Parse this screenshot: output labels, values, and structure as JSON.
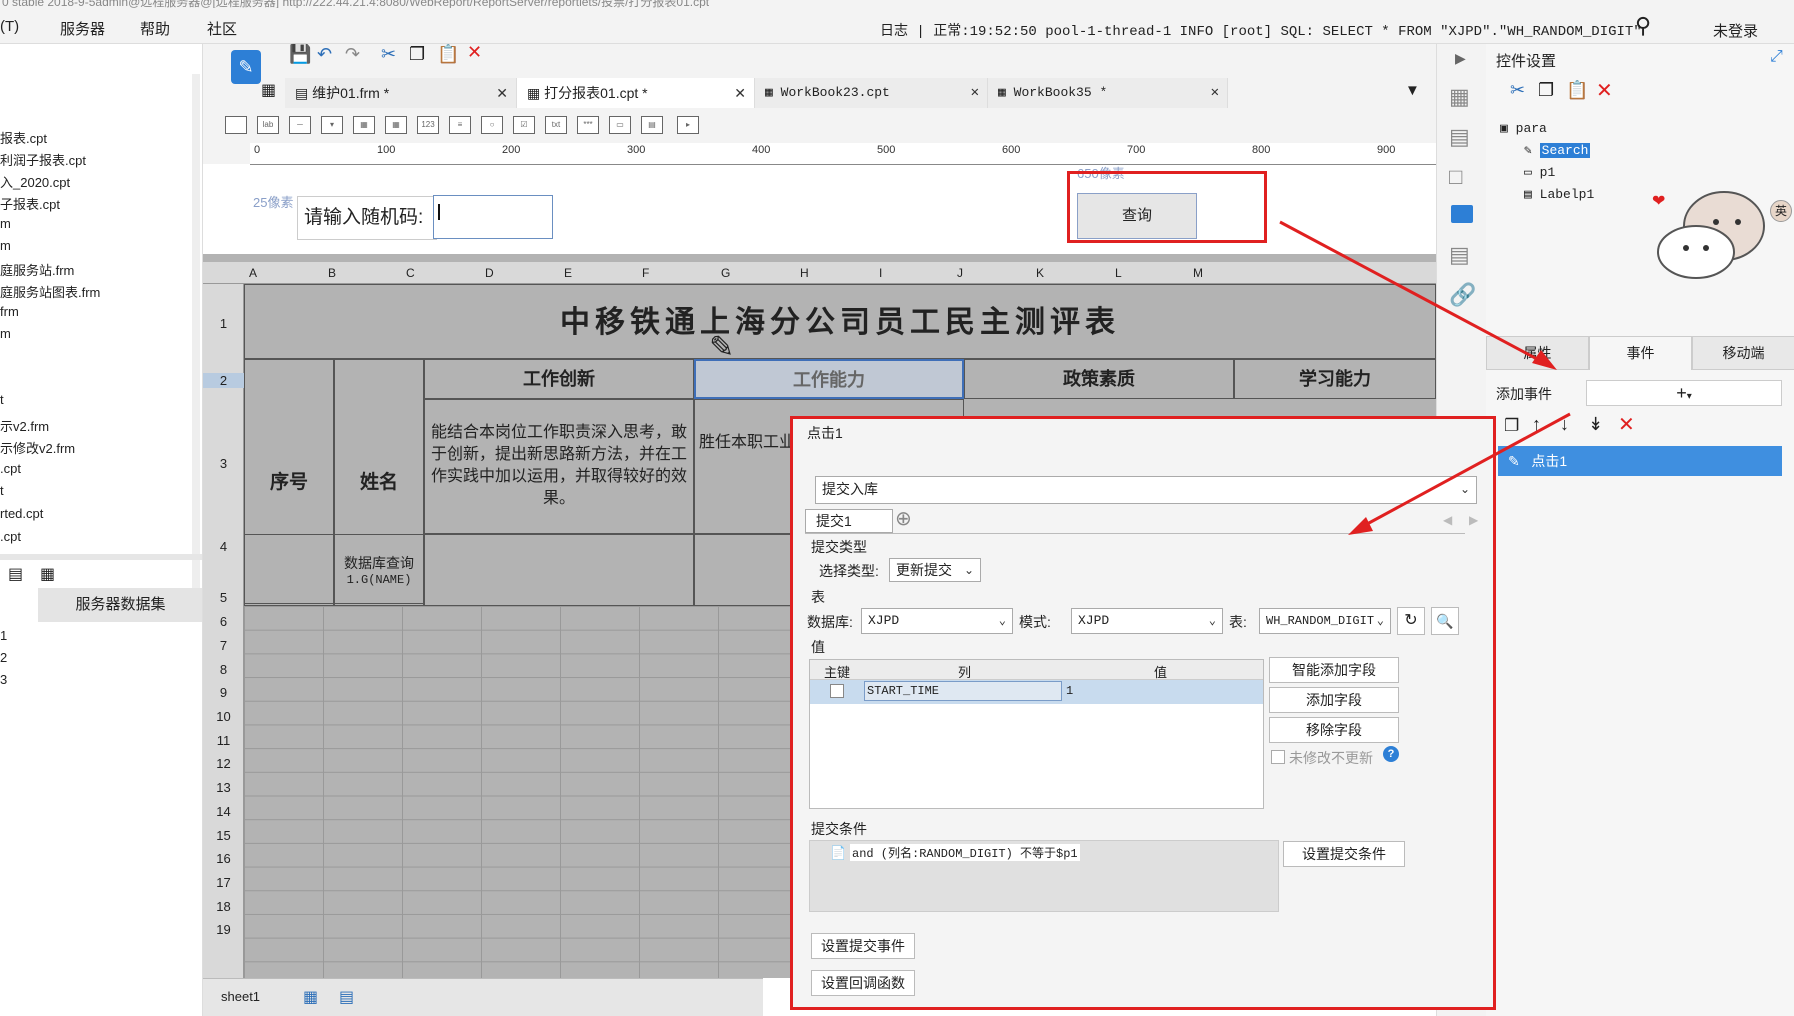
{
  "window": {
    "title": "0 stable 2018-9-5admin@远程服务器@[远程服务器] http://222.44.21.4:8080/WebReport/ReportServer/reportlets/投票/打分报表01.cpt"
  },
  "menubar": {
    "items": [
      "(T)",
      "服务器",
      "帮助",
      "社区"
    ],
    "log": "日志 | 正常:19:52:50 pool-1-thread-1 INFO [root] SQL: SELECT * FROM \"XJPD\".\"WH_RANDOM_DIGIT\"",
    "login": "未登录"
  },
  "left_panel": {
    "files": [
      "报表.cpt",
      "利润子报表.cpt",
      "入_2020.cpt",
      "子报表.cpt",
      "m",
      "m",
      "庭服务站.frm",
      "庭服务站图表.frm",
      "frm",
      "m",
      "",
      "",
      "t",
      "示v2.frm",
      "示修改v2.frm",
      ".cpt",
      "t",
      "rted.cpt",
      ".cpt"
    ],
    "dataset_header": "服务器数据集",
    "datasets": [
      "1",
      "2",
      "3"
    ]
  },
  "tabs": [
    {
      "label": "维护01.frm *",
      "icon": "form-icon"
    },
    {
      "label": "打分报表01.cpt *",
      "icon": "grid-icon"
    },
    {
      "label": "WorkBook23.cpt",
      "icon": "grid-icon"
    },
    {
      "label": "WorkBook35 *",
      "icon": "grid-icon"
    }
  ],
  "ruler_ticks": [
    "0",
    "100",
    "200",
    "300",
    "400",
    "500",
    "600",
    "700",
    "800",
    "900"
  ],
  "param_pane": {
    "label": "请输入随机码:",
    "input_value": "",
    "query_button": "查询",
    "hint_left": "25像素",
    "hint_top": "650像素"
  },
  "grid": {
    "columns": [
      "A",
      "B",
      "C",
      "D",
      "E",
      "F",
      "G",
      "H",
      "I",
      "J",
      "K",
      "L",
      "M"
    ],
    "rows": [
      "1",
      "2",
      "3",
      "4",
      "5",
      "6",
      "7",
      "8",
      "9",
      "10",
      "11",
      "12",
      "13",
      "14",
      "15",
      "16",
      "17",
      "18",
      "19"
    ],
    "report_title": "中移铁通上海分公司员工民主测评表",
    "col_no": "序号",
    "col_name": "姓名",
    "h_innovation": "工作创新",
    "h_ability": "工作能力",
    "h_policy": "政策素质",
    "h_learning": "学习能力",
    "desc_innovation": "能结合本岗位工作职责深入思考，敢于创新，提出新思路新方法，并在工作实践中加以运用，并取得较好的效果。",
    "desc_ability": "胜任本职工业务水平和开展工作，",
    "db_query": "数据库查询",
    "db_field": "1.G(NAME)",
    "sheet_tab": "sheet1"
  },
  "right_panel": {
    "title": "控件设置",
    "tree": [
      "para",
      "Search",
      "p1",
      "Labelp1"
    ],
    "tabs": [
      "属性",
      "事件",
      "移动端"
    ],
    "add_event_label": "添加事件",
    "event_item": "点击1"
  },
  "dialog": {
    "title": "点击1",
    "action_type": "提交入库",
    "sub_tab": "提交1",
    "submit_type_section": "提交类型",
    "select_type_label": "选择类型:",
    "select_type_value": "更新提交",
    "table_section": "表",
    "db_label": "数据库:",
    "db_value": "XJPD",
    "schema_label": "模式:",
    "schema_value": "XJPD",
    "table_label": "表:",
    "table_value": "WH_RANDOM_DIGIT",
    "value_section": "值",
    "col_headers": [
      "主键",
      "列",
      "值"
    ],
    "rows": [
      {
        "column": "START_TIME",
        "value": "1"
      }
    ],
    "btn_smart_add": "智能添加字段",
    "btn_add": "添加字段",
    "btn_remove": "移除字段",
    "unmodified_label": "未修改不更新",
    "cond_section": "提交条件",
    "condition": "and (列名:RANDOM_DIGIT) 不等于$p1",
    "btn_set_cond": "设置提交条件",
    "btn_submit_event": "设置提交事件",
    "btn_callback": "设置回调函数"
  },
  "colors": {
    "highlight": "#e02020",
    "selection": "#3f8fe0",
    "grid_bg": "#b3b3b3"
  }
}
